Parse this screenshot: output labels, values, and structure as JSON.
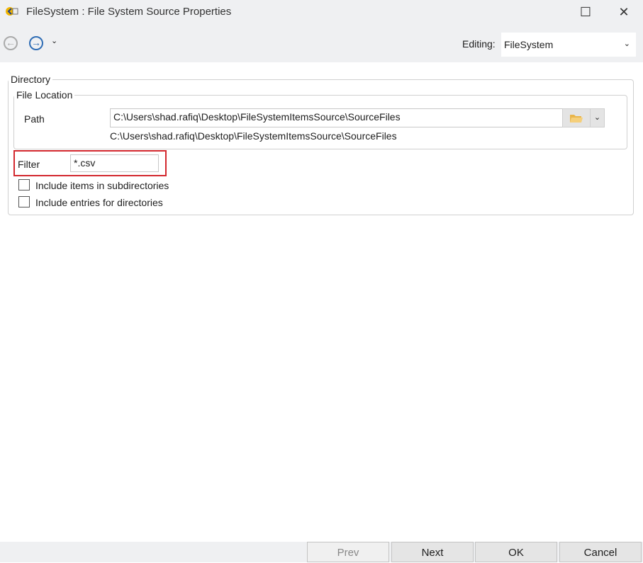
{
  "window": {
    "title": "FileSystem : File System Source Properties"
  },
  "toolbar": {
    "editing_label": "Editing:",
    "editing_value": "FileSystem"
  },
  "directory": {
    "legend": "Directory",
    "file_location": {
      "legend": "File Location",
      "path_label": "Path",
      "path_value": "C:\\Users\\shad.rafiq\\Desktop\\FileSystemItemsSource\\SourceFiles",
      "path_resolved": "C:\\Users\\shad.rafiq\\Desktop\\FileSystemItemsSource\\SourceFiles"
    },
    "filter_label": "Filter",
    "filter_value": "*.csv",
    "checkboxes": [
      {
        "label": "Include items in subdirectories",
        "checked": false
      },
      {
        "label": "Include entries for directories",
        "checked": false
      }
    ]
  },
  "footer": {
    "prev": "Prev",
    "next": "Next",
    "ok": "OK",
    "cancel": "Cancel"
  },
  "colors": {
    "highlight": "#d3282e",
    "accent": "#2f6db5"
  }
}
